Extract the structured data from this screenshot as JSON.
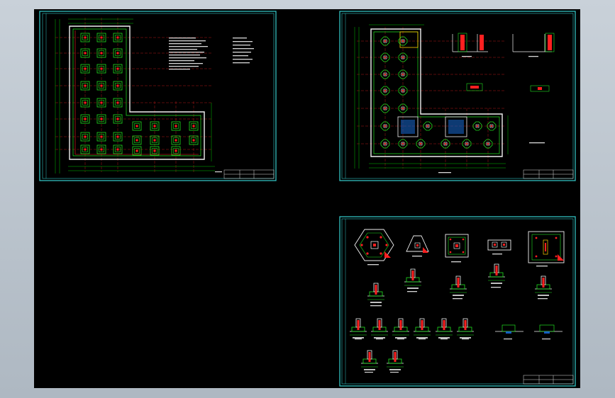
{
  "viewer": {
    "background": "#000000",
    "frame_color": "#b4bec8"
  },
  "colors": {
    "sheet_border": "#31c0c0",
    "wall": "#f0f0f0",
    "dim_line": "#00c000",
    "axis_line": "#e02020",
    "footing": "#20e020",
    "rebar": "#ff2020",
    "text": "#e0e0e0"
  },
  "sheets": [
    {
      "id": "foundation-plan",
      "title_block_label": ""
    },
    {
      "id": "column-plan",
      "title_block_label": ""
    },
    {
      "id": "footing-details",
      "title_block_label": ""
    }
  ]
}
